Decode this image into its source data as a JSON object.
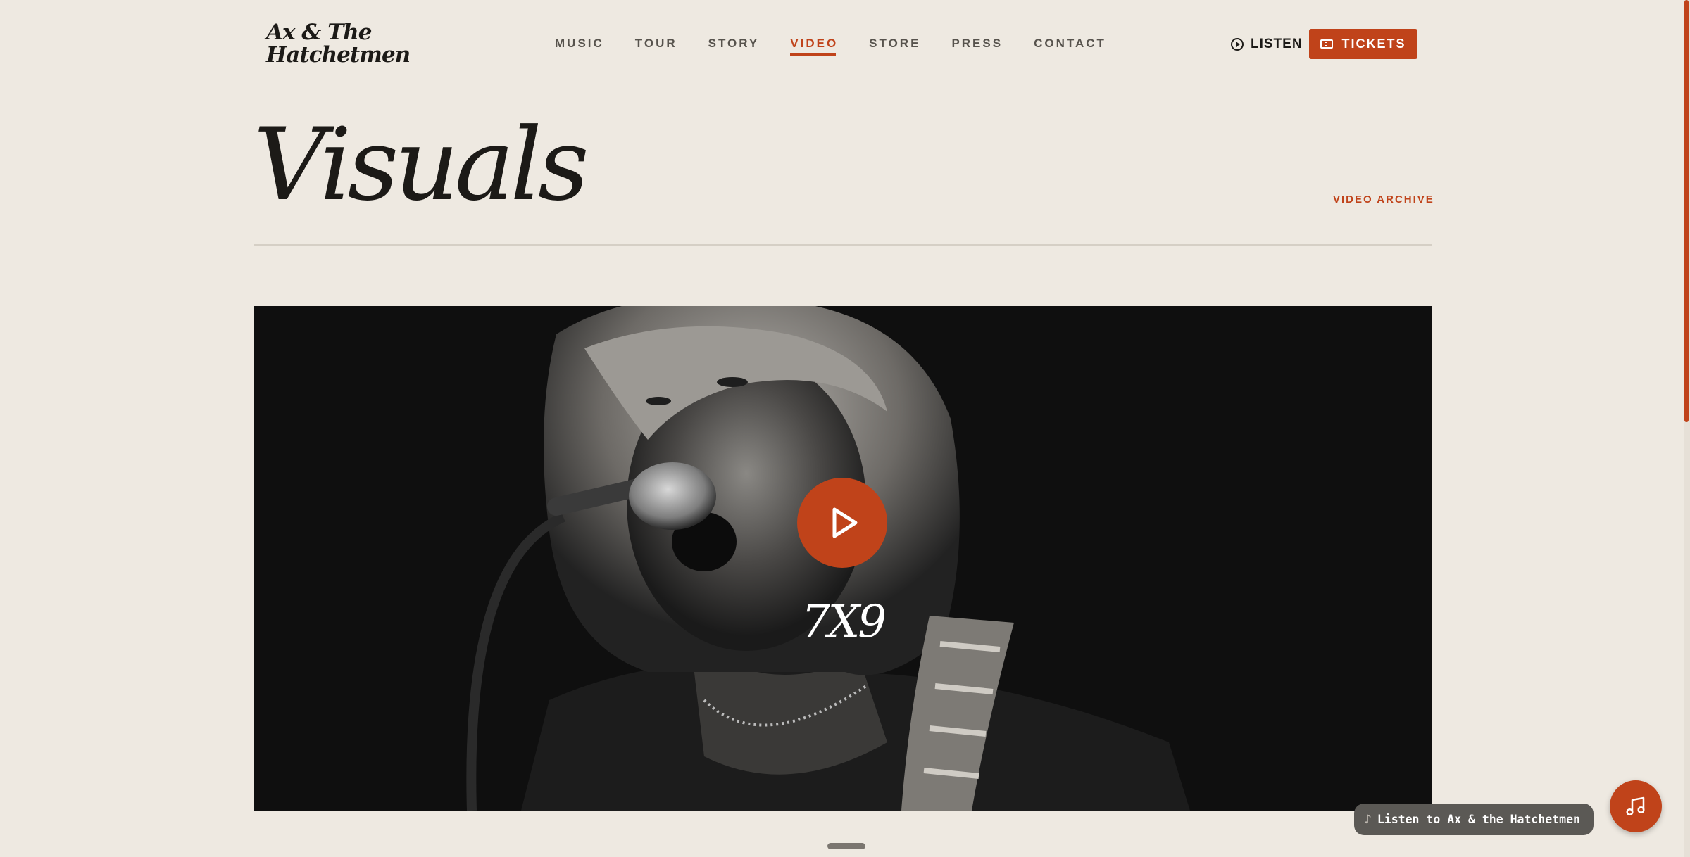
{
  "brand": {
    "name_line1": "Ax & The",
    "name_line2": "Hatchetmen"
  },
  "nav": {
    "items": [
      {
        "label": "MUSIC",
        "active": false
      },
      {
        "label": "TOUR",
        "active": false
      },
      {
        "label": "STORY",
        "active": false
      },
      {
        "label": "VIDEO",
        "active": true
      },
      {
        "label": "STORE",
        "active": false
      },
      {
        "label": "PRESS",
        "active": false
      },
      {
        "label": "CONTACT",
        "active": false
      }
    ],
    "listen_label": "LISTEN",
    "tickets_label": "TICKETS"
  },
  "page": {
    "title": "Visuals",
    "archive_link": "VIDEO ARCHIVE"
  },
  "video": {
    "title": "7X9"
  },
  "player": {
    "pill_label": "Listen to Ax & the Hatchetmen"
  },
  "icons": {
    "listen": "play-circle-icon",
    "tickets": "ticket-icon",
    "play": "play-icon",
    "music": "music-note-icon"
  },
  "colors": {
    "accent": "#c0431a",
    "background": "#eee9e1",
    "text": "#1c1a17"
  }
}
